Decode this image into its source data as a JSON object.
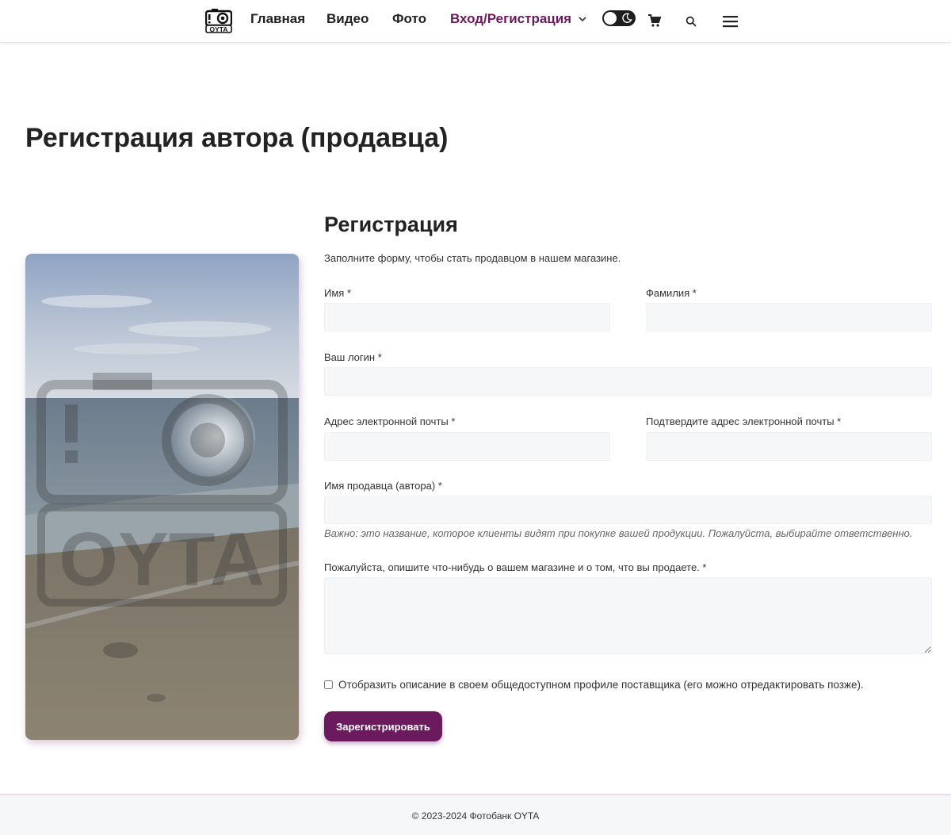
{
  "header": {
    "logo_text": "OYTA",
    "nav": [
      {
        "label": "Главная"
      },
      {
        "label": "Видео"
      },
      {
        "label": "Фото"
      },
      {
        "label": "Вход/Регистрация",
        "active": true
      }
    ],
    "accent_color": "#6b1a5e",
    "icons": [
      "dark-mode-toggle",
      "cart-icon",
      "search-icon",
      "menu-icon"
    ]
  },
  "page": {
    "title": "Регистрация автора (продавца)"
  },
  "form": {
    "title": "Регистрация",
    "description": "Заполните форму, чтобы стать продавцом в нашем магазине.",
    "first_name_label": "Имя *",
    "first_name_value": "",
    "last_name_label": "Фамилия *",
    "last_name_value": "",
    "login_label": "Ваш логин *",
    "login_value": "",
    "email_label": "Адрес электронной почты *",
    "email_value": "",
    "email_confirm_label": "Подтвердите адрес электронной почты *",
    "email_confirm_value": "",
    "vendor_name_label": "Имя продавца (автора) *",
    "vendor_name_value": "",
    "vendor_name_hint": "Важно: это название, которое клиенты видят при покупке вашей продукции. Пожалуйста, выбирайте ответственно.",
    "about_label": "Пожалуйста, опишите что-нибудь о вашем магазине и о том, что вы продаете. *",
    "about_value": "",
    "show_description_label": "Отобразить описание в своем общедоступном профиле поставщика (его можно отредактировать позже).",
    "show_description_checked": false,
    "submit_label": "Зарегистрировать"
  },
  "image": {
    "watermark_text": "OYTA"
  },
  "footer": {
    "copyright": "© 2023-2024 Фотобанк OYTA"
  }
}
